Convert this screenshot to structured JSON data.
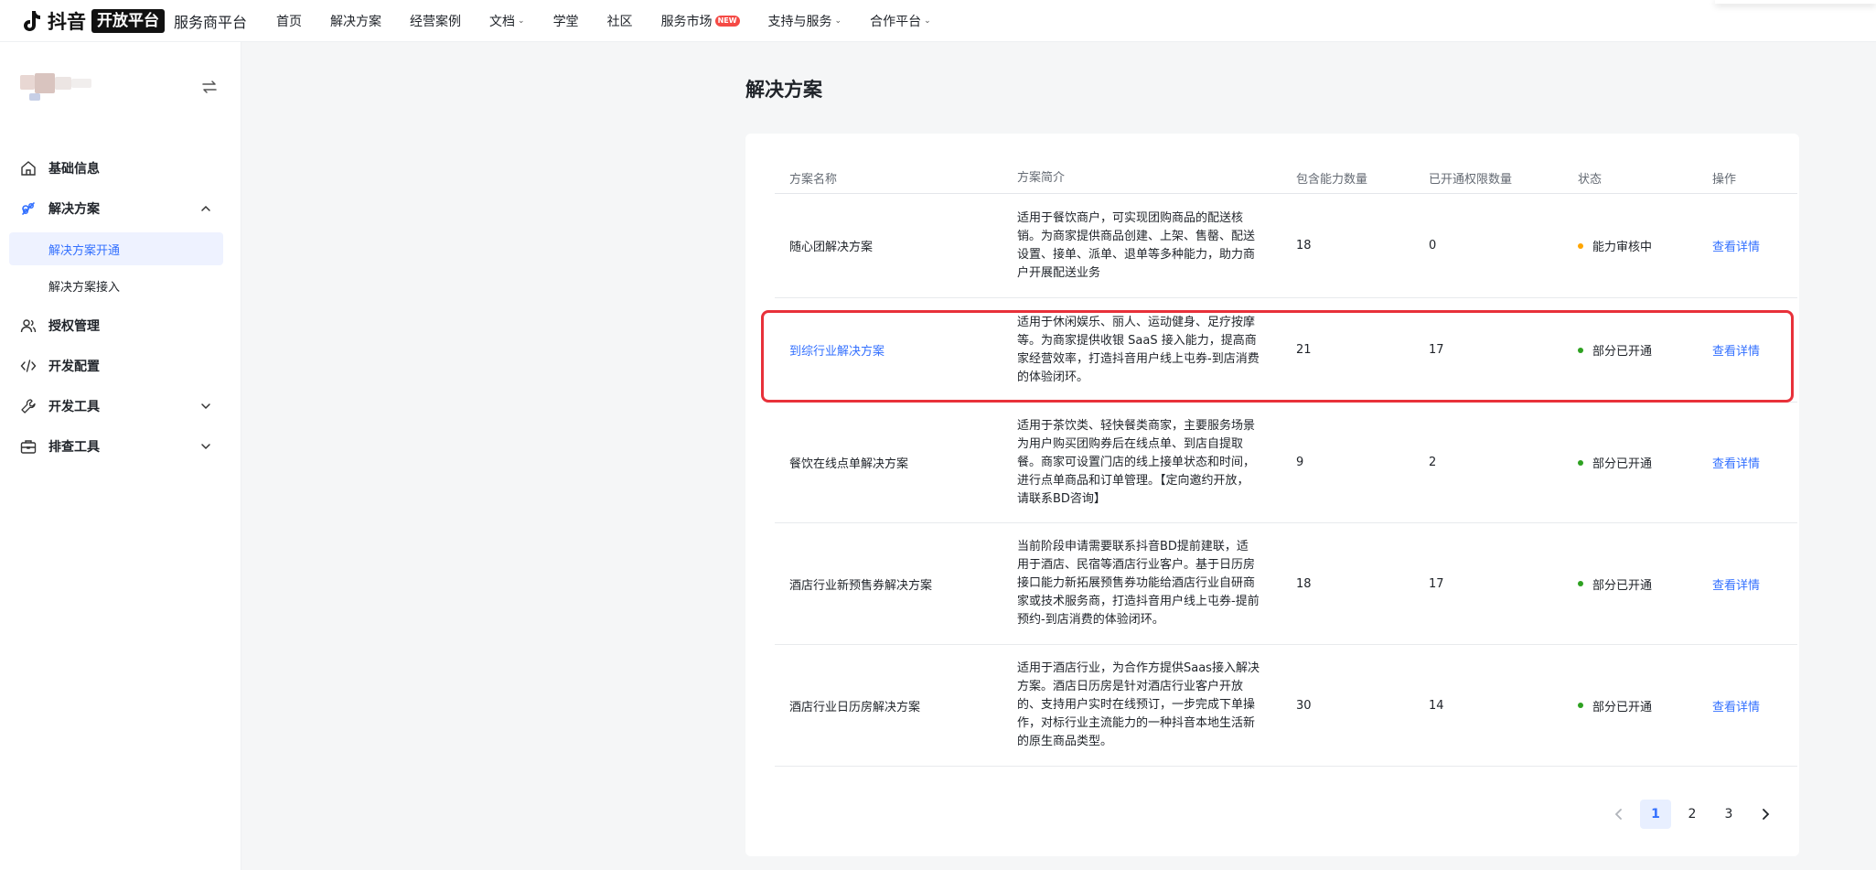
{
  "topbar": {
    "logo_text": "抖音",
    "logo_badge": "开放平台",
    "platform": "服务商平台",
    "nav": [
      {
        "label": "首页",
        "has_dropdown": false
      },
      {
        "label": "解决方案",
        "has_dropdown": false
      },
      {
        "label": "经营案例",
        "has_dropdown": false
      },
      {
        "label": "文档",
        "has_dropdown": true
      },
      {
        "label": "学堂",
        "has_dropdown": false
      },
      {
        "label": "社区",
        "has_dropdown": false
      },
      {
        "label": "服务市场",
        "has_dropdown": false,
        "badge": "NEW"
      },
      {
        "label": "支持与服务",
        "has_dropdown": true
      },
      {
        "label": "合作平台",
        "has_dropdown": true
      }
    ]
  },
  "sidebar": {
    "menu": [
      {
        "label": "基础信息",
        "icon": "home-icon"
      },
      {
        "label": "解决方案",
        "icon": "solution-icon",
        "expanded": true,
        "children": [
          {
            "label": "解决方案开通",
            "active": true
          },
          {
            "label": "解决方案接入",
            "active": false
          }
        ]
      },
      {
        "label": "授权管理",
        "icon": "users-icon"
      },
      {
        "label": "开发配置",
        "icon": "code-icon"
      },
      {
        "label": "开发工具",
        "icon": "wrench-icon",
        "expanded": false
      },
      {
        "label": "排查工具",
        "icon": "toolbox-icon",
        "expanded": false
      }
    ]
  },
  "main": {
    "title": "解决方案",
    "table": {
      "columns": [
        "方案名称",
        "方案简介",
        "包含能力数量",
        "已开通权限数量",
        "状态",
        "操作"
      ],
      "rows": [
        {
          "name": "随心团解决方案",
          "desc": "适用于餐饮商户，可实现团购商品的配送核销。为商家提供商品创建、上架、售罄、配送设置、接单、派单、退单等多种能力，助力商户开展配送业务",
          "abilities": "18",
          "opened": "0",
          "status": "能力审核中",
          "status_color": "#ffa500",
          "action": "查看详情",
          "highlight": false
        },
        {
          "name": "到综行业解决方案",
          "desc": "适用于休闲娱乐、丽人、运动健身、足疗按摩等。为商家提供收银 SaaS 接入能力，提高商家经营效率，打造抖音用户线上屯券-到店消费的体验闭环。",
          "abilities": "21",
          "opened": "17",
          "status": "部分已开通",
          "status_color": "#2ea121",
          "action": "查看详情",
          "highlight": true
        },
        {
          "name": "餐饮在线点单解决方案",
          "desc": "适用于茶饮类、轻快餐类商家，主要服务场景为用户购买团购券后在线点单、到店自提取餐。商家可设置门店的线上接单状态和时间，进行点单商品和订单管理。【定向邀约开放，请联系BD咨询】",
          "abilities": "9",
          "opened": "2",
          "status": "部分已开通",
          "status_color": "#2ea121",
          "action": "查看详情",
          "highlight": false
        },
        {
          "name": "酒店行业新预售券解决方案",
          "desc": "当前阶段申请需要联系抖音BD提前建联，适用于酒店、民宿等酒店行业客户。基于日历房接口能力新拓展预售券功能给酒店行业自研商家或技术服务商，打造抖音用户线上屯券-提前预约-到店消费的体验闭环。",
          "abilities": "18",
          "opened": "17",
          "status": "部分已开通",
          "status_color": "#2ea121",
          "action": "查看详情",
          "highlight": false
        },
        {
          "name": "酒店行业日历房解决方案",
          "desc": "适用于酒店行业，为合作方提供Saas接入解决方案。酒店日历房是针对酒店行业客户开放的、支持用户实时在线预订，一步完成下单操作，对标行业主流能力的一种抖音本地生活新的原生商品类型。",
          "abilities": "30",
          "opened": "14",
          "status": "部分已开通",
          "status_color": "#2ea121",
          "action": "查看详情",
          "highlight": false
        }
      ]
    },
    "pagination": {
      "pages": [
        "1",
        "2",
        "3"
      ],
      "current": "1"
    }
  }
}
